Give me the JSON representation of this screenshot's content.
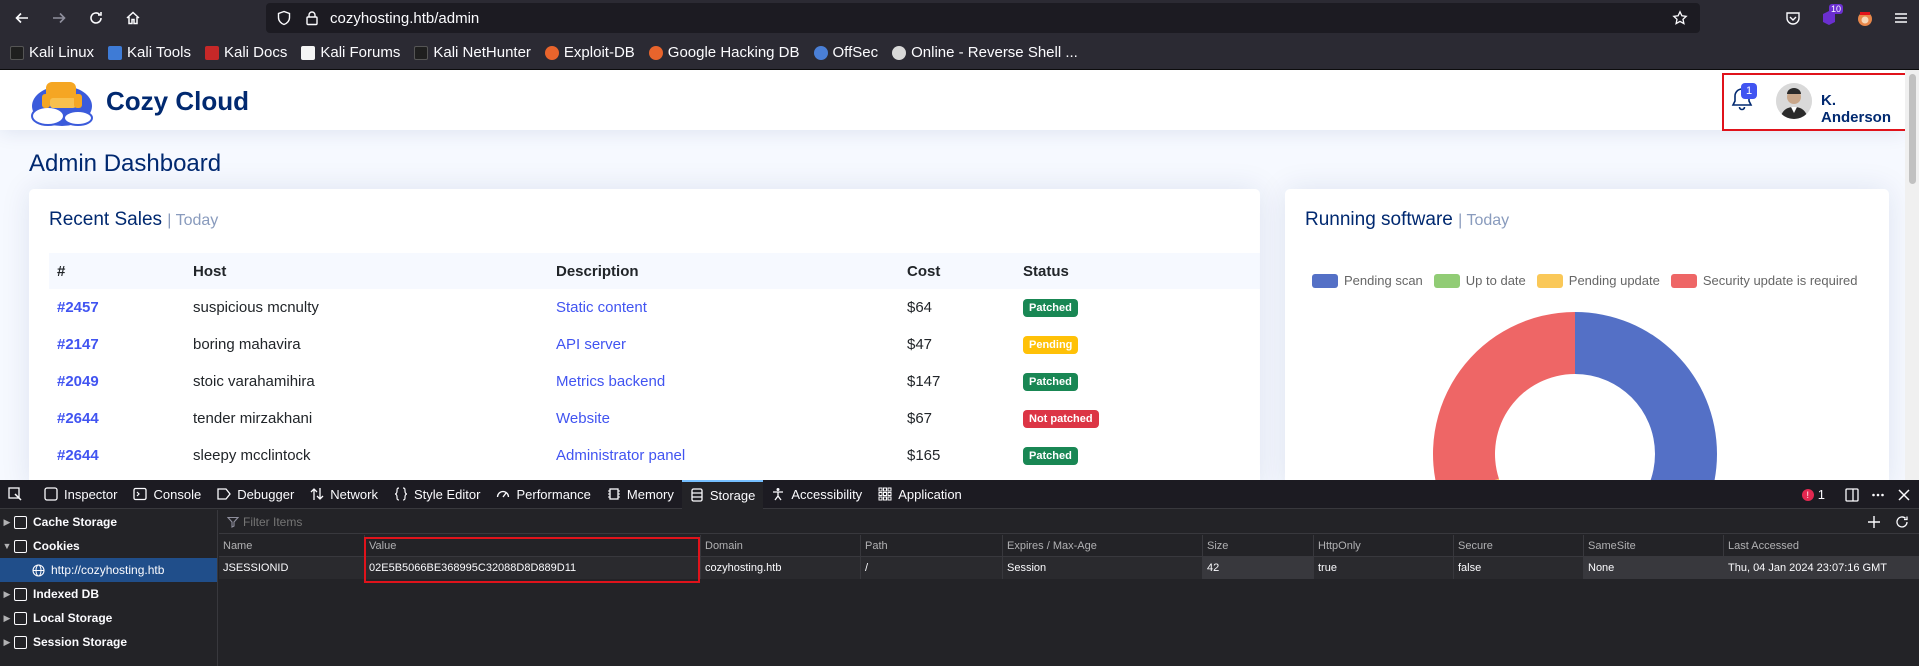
{
  "browser": {
    "url": "cozyhosting.htb/admin",
    "extension_badge": "10",
    "bookmarks": [
      "Kali Linux",
      "Kali Tools",
      "Kali Docs",
      "Kali Forums",
      "Kali NetHunter",
      "Exploit-DB",
      "Google Hacking DB",
      "OffSec",
      "Online - Reverse Shell ..."
    ]
  },
  "site": {
    "brand": "Cozy Cloud",
    "notification_count": "1",
    "user_name": "K. Anderson",
    "page_title": "Admin Dashboard"
  },
  "recent_sales": {
    "title": "Recent Sales",
    "subtitle": "| Today",
    "columns": [
      "#",
      "Host",
      "Description",
      "Cost",
      "Status"
    ],
    "rows": [
      {
        "id": "#2457",
        "host": "suspicious mcnulty",
        "description": "Static content",
        "cost": "$64",
        "status": "Patched"
      },
      {
        "id": "#2147",
        "host": "boring mahavira",
        "description": "API server",
        "cost": "$47",
        "status": "Pending"
      },
      {
        "id": "#2049",
        "host": "stoic varahamihira",
        "description": "Metrics backend",
        "cost": "$147",
        "status": "Patched"
      },
      {
        "id": "#2644",
        "host": "tender mirzakhani",
        "description": "Website",
        "cost": "$67",
        "status": "Not patched"
      },
      {
        "id": "#2644",
        "host": "sleepy mcclintock",
        "description": "Administrator panel",
        "cost": "$165",
        "status": "Patched"
      }
    ],
    "status_colors": {
      "Patched": "#198754",
      "Pending": "#ffc107",
      "Not patched": "#dc3545"
    }
  },
  "running_software": {
    "title": "Running software",
    "subtitle": "| Today",
    "legend": [
      {
        "label": "Pending scan",
        "color": "#5470c6"
      },
      {
        "label": "Up to date",
        "color": "#91cc75"
      },
      {
        "label": "Pending update",
        "color": "#fac858"
      },
      {
        "label": "Security update is required",
        "color": "#ee6666"
      }
    ]
  },
  "chart_data": {
    "type": "pie",
    "categories": [
      "Pending scan",
      "Up to date",
      "Pending update",
      "Security update is required"
    ],
    "values": [
      50,
      0,
      20,
      30
    ],
    "colors": [
      "#5470c6",
      "#91cc75",
      "#fac858",
      "#ee6666"
    ],
    "legend_position": "top"
  },
  "devtools": {
    "tabs": [
      "Inspector",
      "Console",
      "Debugger",
      "Network",
      "Style Editor",
      "Performance",
      "Memory",
      "Storage",
      "Accessibility",
      "Application"
    ],
    "selected_tab": "Storage",
    "error_count": "1",
    "sidebar": [
      "Cache Storage",
      "Cookies",
      "http://cozyhosting.htb",
      "Indexed DB",
      "Local Storage",
      "Session Storage"
    ],
    "filter_placeholder": "Filter Items",
    "cookie_columns": [
      "Name",
      "Value",
      "Domain",
      "Path",
      "Expires / Max-Age",
      "Size",
      "HttpOnly",
      "Secure",
      "SameSite",
      "Last Accessed"
    ],
    "cookie_row": [
      "JSESSIONID",
      "02E5B5066BE368995C32088D8D889D11",
      "cozyhosting.htb",
      "/",
      "Session",
      "42",
      "true",
      "false",
      "None",
      "Thu, 04 Jan 2024 23:07:16 GMT"
    ]
  }
}
